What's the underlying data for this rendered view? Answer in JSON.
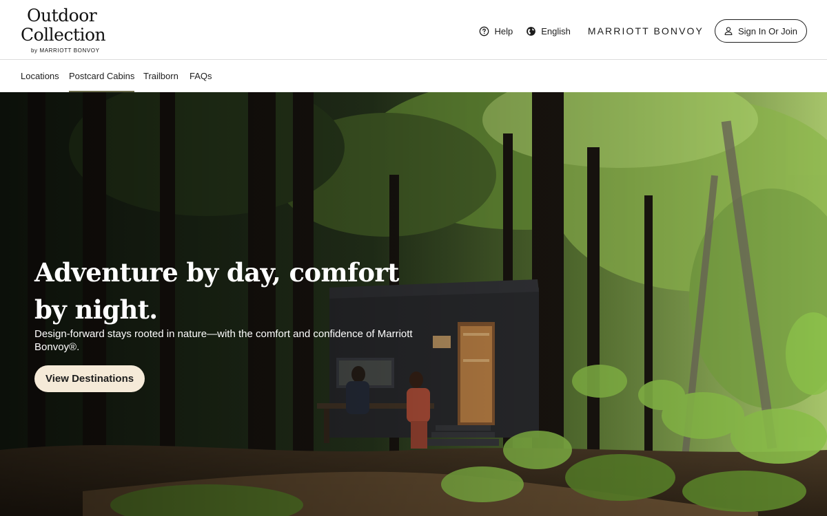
{
  "brand": {
    "logo_line1": "Outdoor",
    "logo_line2": "Collection",
    "logo_sub": "by MARRIOTT BONVOY"
  },
  "header": {
    "help_label": "Help",
    "language_label": "English",
    "bonvoy_wordmark": "MARRIOTT BONVOY",
    "signin_label": "Sign In Or Join"
  },
  "subnav": {
    "items": [
      {
        "label": "Locations",
        "active": false
      },
      {
        "label": "Postcard Cabins",
        "active": true
      },
      {
        "label": "Trailborn",
        "active": false
      },
      {
        "label": "FAQs",
        "active": false
      }
    ]
  },
  "hero": {
    "title_line1": "Adventure by day, comfort",
    "title_line2": "by night.",
    "subtitle": "Design-forward stays rooted in nature—with the comfort and confidence of Marriott Bonvoy®.",
    "cta_label": "View Destinations",
    "cabin_sign": "",
    "image": "forest-cabin-photo"
  },
  "icons": {
    "help": "help-circle-icon",
    "language": "globe-icon",
    "account": "user-icon"
  },
  "colors": {
    "cta_bg": "#f5ead8",
    "active_underline": "#6e6e4e",
    "text_dark": "#1c1c1c",
    "divider": "#dcdcdc"
  }
}
